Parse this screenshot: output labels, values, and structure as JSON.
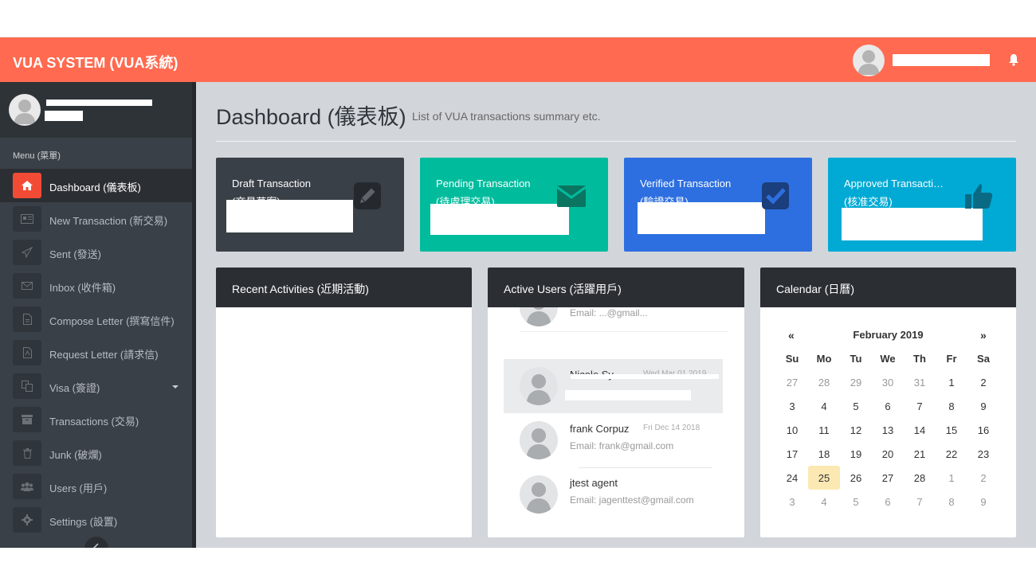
{
  "app": {
    "title": "VUA SYSTEM (VUA系統)"
  },
  "colors": {
    "header": "#ff6a50",
    "sidebar": "#3a4047",
    "accent": "#f24b35"
  },
  "sidebar": {
    "menu_title": "Menu (菜單)",
    "items": [
      {
        "label": "Dashboard (儀表板)",
        "icon": "home-icon",
        "active": true
      },
      {
        "label": "New Transaction (新交易)",
        "icon": "id-card-icon"
      },
      {
        "label": "Sent (發送)",
        "icon": "paper-plane-icon"
      },
      {
        "label": "Inbox (收件箱)",
        "icon": "envelope-icon"
      },
      {
        "label": "Compose Letter (撰寫信件)",
        "icon": "document-icon"
      },
      {
        "label": "Request Letter (請求信)",
        "icon": "pdf-icon"
      },
      {
        "label": "Visa (簽證)",
        "icon": "copy-icon",
        "has_submenu": true
      },
      {
        "label": "Transactions (交易)",
        "icon": "archive-icon"
      },
      {
        "label": "Junk (破爛)",
        "icon": "trash-icon"
      },
      {
        "label": "Users (用戶)",
        "icon": "users-icon"
      },
      {
        "label": "Settings (設置)",
        "icon": "gear-icon"
      }
    ]
  },
  "page": {
    "title": "Dashboard (儀表板)",
    "subtitle": "List of VUA transactions summary etc."
  },
  "stats": [
    {
      "line1": "Draft Transaction",
      "line2": "(交易草案)",
      "color": "#3a4047",
      "icon": "pencil-icon"
    },
    {
      "line1": "Pending Transaction",
      "line2": "(待處理交易)",
      "color": "#00bc9d",
      "icon": "envelope-icon"
    },
    {
      "line1": "Verified Transaction",
      "line2": "(驗證交易)",
      "color": "#2d6fe0",
      "icon": "check-icon"
    },
    {
      "line1": "Approved Transacti…",
      "line2": "(核准交易)",
      "color": "#00aad4",
      "icon": "thumbs-up-icon"
    }
  ],
  "panels": {
    "recent": "Recent Activities (近期活動)",
    "active_users": "Active Users (活躍用戶)",
    "calendar": "Calendar (日曆)"
  },
  "users": [
    {
      "name": "",
      "date": "",
      "email": "Email: ...@gmail..."
    },
    {
      "name": "Nicole Sy",
      "date": "Wed Mar 01 2019",
      "email": ""
    },
    {
      "name": "frank Corpuz",
      "date": "Fri Dec 14 2018",
      "email": "Email: frank@gmail.com"
    },
    {
      "name": "jtest agent",
      "date": "",
      "email": "Email: jagenttest@gmail.com"
    }
  ],
  "calendar": {
    "prev": "«",
    "next": "»",
    "month": "February 2019",
    "dow": [
      "Su",
      "Mo",
      "Tu",
      "We",
      "Th",
      "Fr",
      "Sa"
    ],
    "weeks": [
      [
        "27",
        "28",
        "29",
        "30",
        "31",
        "1",
        "2"
      ],
      [
        "3",
        "4",
        "5",
        "6",
        "7",
        "8",
        "9"
      ],
      [
        "10",
        "11",
        "12",
        "13",
        "14",
        "15",
        "16"
      ],
      [
        "17",
        "18",
        "19",
        "20",
        "21",
        "22",
        "23"
      ],
      [
        "24",
        "25",
        "26",
        "27",
        "28",
        "1",
        "2"
      ],
      [
        "3",
        "4",
        "5",
        "6",
        "7",
        "8",
        "9"
      ]
    ],
    "today": "25"
  }
}
